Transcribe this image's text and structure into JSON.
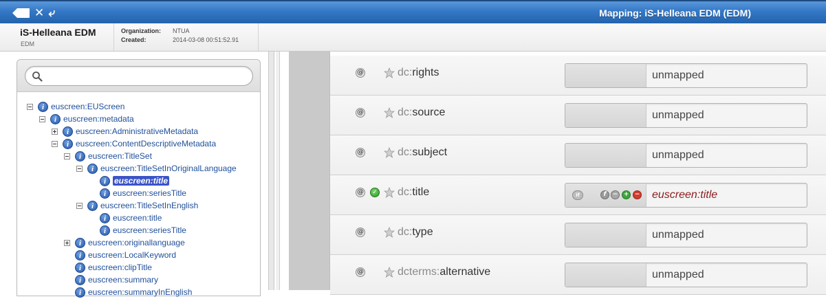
{
  "window": {
    "title": "Mapping: iS-Helleana EDM (EDM)"
  },
  "project": {
    "name": "iS-Helleana EDM",
    "schema": "EDM",
    "organization_label": "Organization:",
    "organization_value": "NTUA",
    "created_label": "Created:",
    "created_value": "2014-03-08 00:51:52.91"
  },
  "search": {
    "placeholder": "",
    "value": ""
  },
  "tree": [
    {
      "label": "euscreen:EUScreen",
      "toggle": "minus",
      "selected": false
    },
    {
      "label": "euscreen:metadata",
      "toggle": "minus",
      "selected": false
    },
    {
      "label": "euscreen:AdministrativeMetadata",
      "toggle": "plus",
      "selected": false
    },
    {
      "label": "euscreen:ContentDescriptiveMetadata",
      "toggle": "minus",
      "selected": false
    },
    {
      "label": "euscreen:TitleSet",
      "toggle": "minus",
      "selected": false
    },
    {
      "label": "euscreen:TitleSetInOriginalLanguage",
      "toggle": "minus",
      "selected": false
    },
    {
      "label": "euscreen:title",
      "toggle": "none",
      "selected": true
    },
    {
      "label": "euscreen:seriesTitle",
      "toggle": "none",
      "selected": false
    },
    {
      "label": "euscreen:TitleSetInEnglish",
      "toggle": "minus",
      "selected": false
    },
    {
      "label": "euscreen:title",
      "toggle": "none",
      "selected": false
    },
    {
      "label": "euscreen:seriesTitle",
      "toggle": "none",
      "selected": false
    },
    {
      "label": "euscreen:originallanguage",
      "toggle": "plus",
      "selected": false
    },
    {
      "label": "euscreen:LocalKeyword",
      "toggle": "none",
      "selected": false
    },
    {
      "label": "euscreen:clipTitle",
      "toggle": "none",
      "selected": false
    },
    {
      "label": "euscreen:summary",
      "toggle": "none",
      "selected": false
    },
    {
      "label": "euscreen:summaryInEnglish",
      "toggle": "none",
      "selected": false
    }
  ],
  "mappings": [
    {
      "prefix": "dc:",
      "name": "rights",
      "value": "unmapped",
      "mapped": false
    },
    {
      "prefix": "dc:",
      "name": "source",
      "value": "unmapped",
      "mapped": false
    },
    {
      "prefix": "dc:",
      "name": "subject",
      "value": "unmapped",
      "mapped": false
    },
    {
      "prefix": "dc:",
      "name": "title",
      "value": "euscreen:title",
      "mapped": true,
      "condition_label": "if",
      "function_label": "f"
    },
    {
      "prefix": "dc:",
      "name": "type",
      "value": "unmapped",
      "mapped": false
    },
    {
      "prefix": "dcterms:",
      "name": "alternative",
      "value": "unmapped",
      "mapped": false
    }
  ],
  "icons": {
    "attribute": "@",
    "check": "✓"
  },
  "colors": {
    "titlebar": "#3478c6",
    "tree_link": "#1f4f9a",
    "selected": "#3b54c7",
    "mapped_value": "#8b1c1c"
  }
}
